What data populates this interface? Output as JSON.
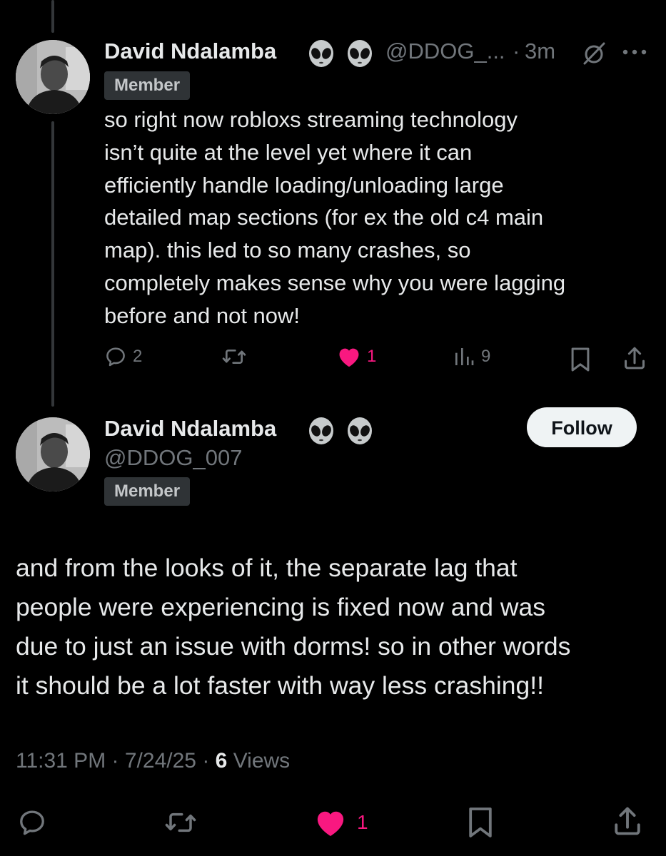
{
  "reply": {
    "author_name": "David Ndalamba",
    "author_handle": "@DDOG_...",
    "separator": "·",
    "time": "3m",
    "badge": "Member",
    "text": "so right now robloxs streaming technology\nisn’t quite at the level yet where it can\nefficiently handle loading/unloading large\ndetailed map sections (for ex the old c4 main\nmap). this led to so many crashes, so\ncompletely makes sense why you were lagging\nbefore and not now!",
    "replies": "2",
    "likes": "1",
    "views": "9"
  },
  "main_post": {
    "author_name": "David Ndalamba",
    "author_handle": "@DDOG_007",
    "badge": "Member",
    "follow_label": "Follow",
    "text": "and from the looks of it, the separate lag that\npeople were experiencing is fixed now and was\ndue to just an issue with dorms! so in other words\nit should be a lot faster with way less crashing!!",
    "time": "11:31 PM",
    "date": "7/24/25",
    "views_count": "6",
    "views_label": "Views",
    "likes": "1"
  },
  "icons": [
    "alien-emoji-icon",
    "grok-icon",
    "more-icon",
    "reply-icon",
    "repost-icon",
    "like-icon",
    "views-icon",
    "bookmark-icon",
    "share-icon"
  ],
  "colors": {
    "background": "#000000",
    "text": "#e7e9ea",
    "secondary": "#71767b",
    "like": "#f91880",
    "badge_bg": "#2f3336",
    "follow_bg": "#eff3f4"
  }
}
